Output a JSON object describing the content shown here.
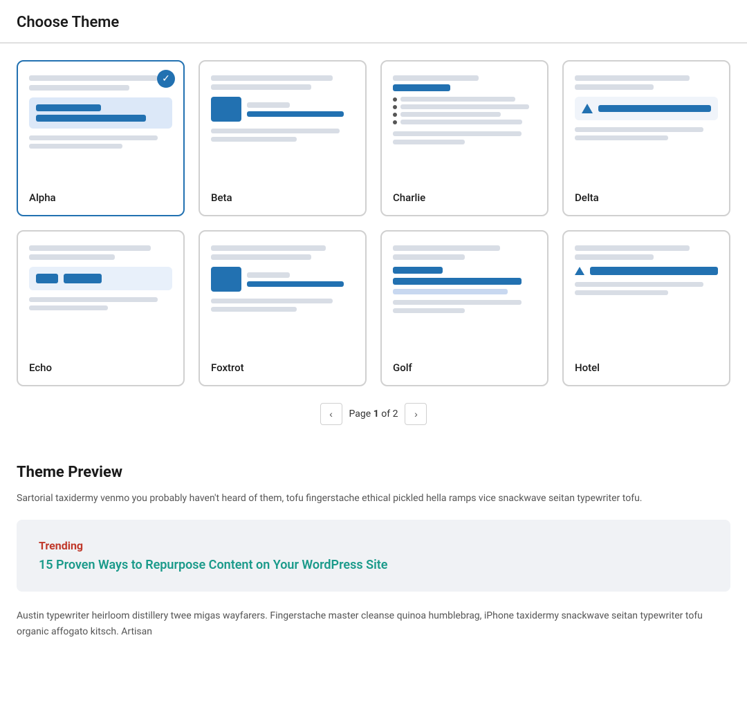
{
  "header": {
    "title": "Choose Theme"
  },
  "themes": {
    "grid_label": "theme grid",
    "items": [
      {
        "id": "alpha",
        "name": "Alpha",
        "selected": true
      },
      {
        "id": "beta",
        "name": "Beta",
        "selected": false
      },
      {
        "id": "charlie",
        "name": "Charlie",
        "selected": false
      },
      {
        "id": "delta",
        "name": "Delta",
        "selected": false
      },
      {
        "id": "echo",
        "name": "Echo",
        "selected": false
      },
      {
        "id": "foxtrot",
        "name": "Foxtrot",
        "selected": false
      },
      {
        "id": "golf",
        "name": "Golf",
        "selected": false
      },
      {
        "id": "hotel",
        "name": "Hotel",
        "selected": false
      }
    ]
  },
  "pagination": {
    "prev_label": "‹",
    "next_label": "›",
    "page_text": "Page",
    "current": "1",
    "of_text": "of",
    "total": "2"
  },
  "preview_section": {
    "title": "Theme Preview",
    "description": "Sartorial taxidermy venmo you probably haven't heard of them, tofu fingerstache ethical pickled hella ramps vice snackwave seitan typewriter tofu.",
    "trending_label": "Trending",
    "trending_link": "15 Proven Ways to Repurpose Content on Your WordPress Site",
    "body_text": "Austin typewriter heirloom distillery twee migas wayfarers. Fingerstache master cleanse quinoa humblebrag, iPhone taxidermy snackwave seitan typewriter tofu organic affogato kitsch. Artisan"
  }
}
